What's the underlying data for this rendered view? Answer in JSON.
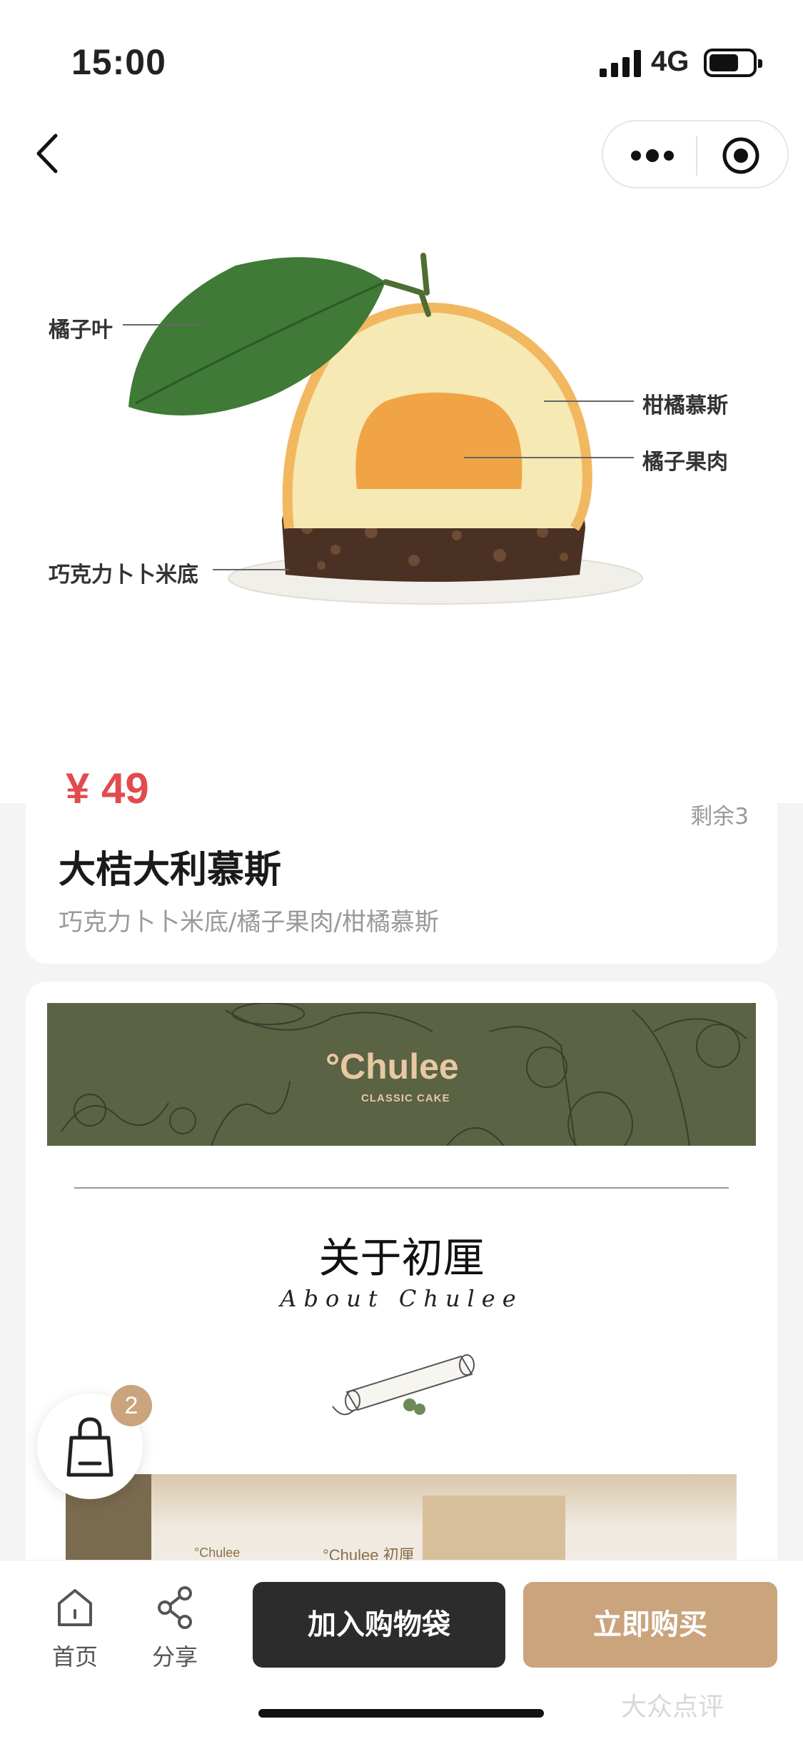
{
  "status_bar": {
    "time": "15:00",
    "network": "4G"
  },
  "nav": {
    "back_icon": "chevron-left-icon",
    "more_icon": "more-dots-icon",
    "target_icon": "target-icon"
  },
  "hero": {
    "labels": {
      "leaf": "橘子叶",
      "mousse": "柑橘慕斯",
      "pulp": "橘子果肉",
      "base": "巧克力卜卜米底"
    }
  },
  "product": {
    "price": "¥ 49",
    "stock": "剩余3",
    "title": "大桔大利慕斯",
    "subtitle": "巧克力卜卜米底/橘子果肉/柑橘慕斯"
  },
  "detail": {
    "brand_name": "°Chulee",
    "brand_sub": "CLASSIC CAKE",
    "about_title": "关于初厘",
    "about_script": "About Chulee",
    "store_sign_left": "°Chulee",
    "store_sign_right": "°Chulee 初厘"
  },
  "cart": {
    "count": "2"
  },
  "bottom_bar": {
    "home": "首页",
    "share": "分享",
    "add_to_cart": "加入购物袋",
    "buy_now": "立即购买"
  },
  "watermark": "大众点评",
  "colors": {
    "price": "#e14b4f",
    "accent": "#c9a47d",
    "dark_button": "#2c2c2c",
    "banner": "#5a6344"
  }
}
